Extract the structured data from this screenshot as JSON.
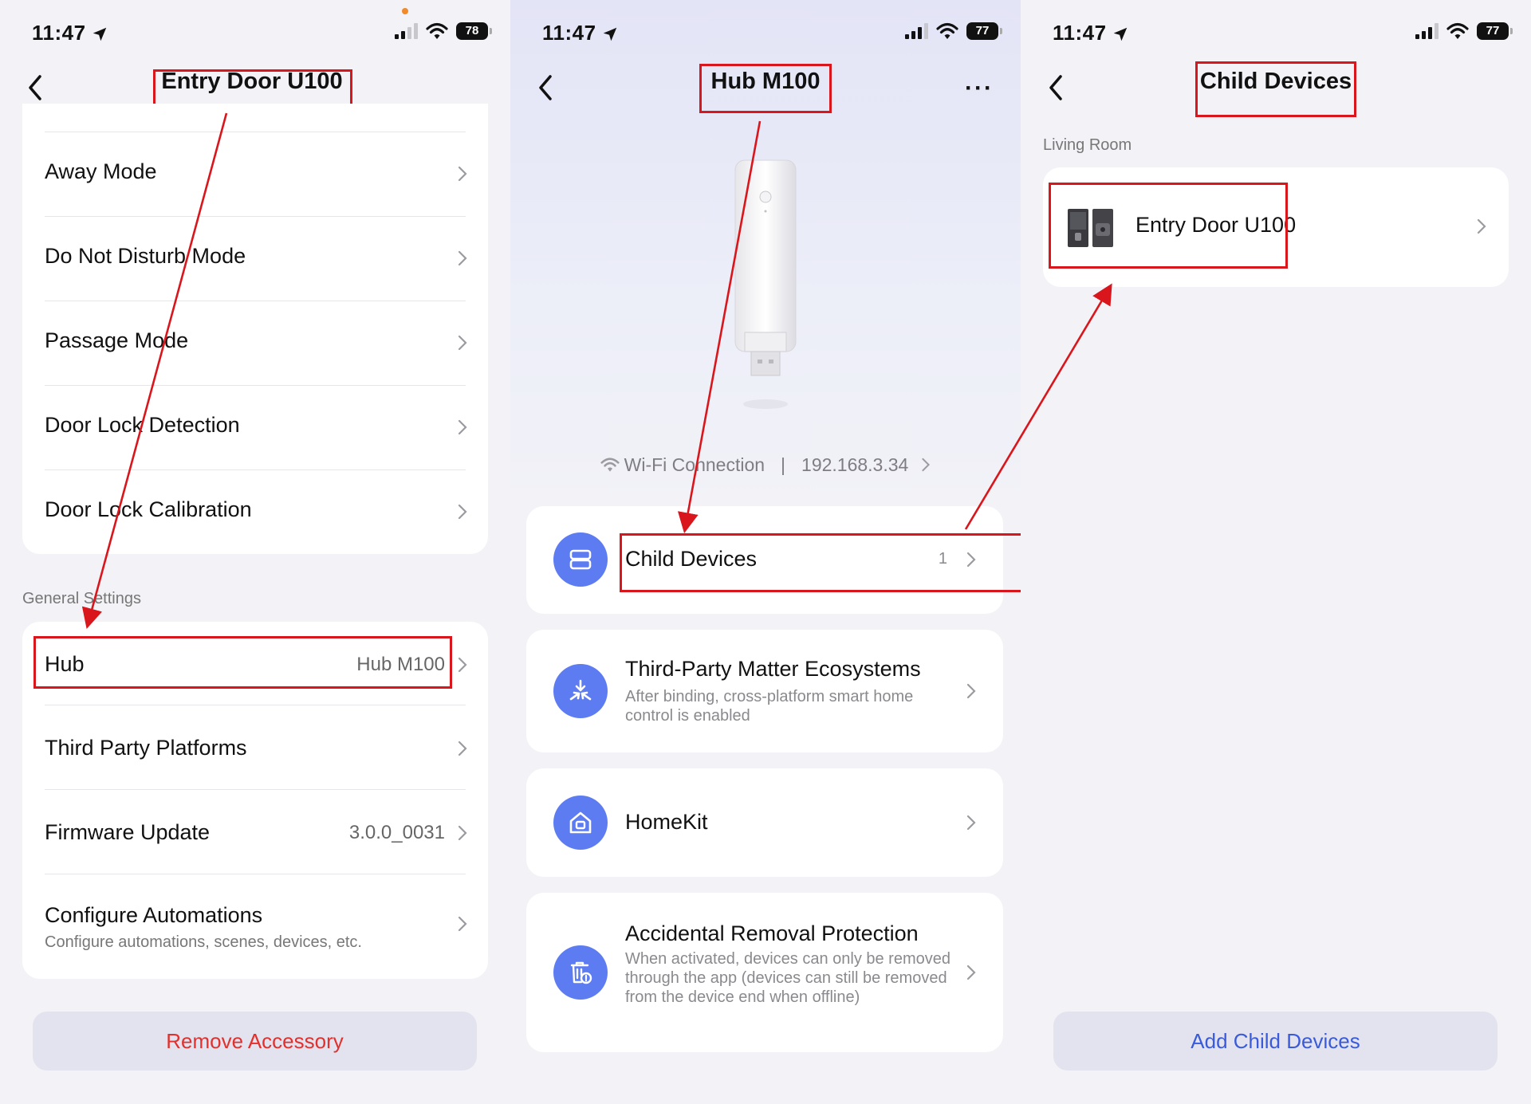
{
  "status_bar": {
    "p1": {
      "time": "11:47",
      "battery": "78"
    },
    "p2": {
      "time": "11:47",
      "battery": "77"
    },
    "p3": {
      "time": "11:47",
      "battery": "77"
    }
  },
  "screen1": {
    "title": "Entry Door U100",
    "rows": [
      {
        "label": "Away Mode"
      },
      {
        "label": "Do Not Disturb Mode"
      },
      {
        "label": "Passage Mode"
      },
      {
        "label": "Door Lock Detection"
      },
      {
        "label": "Door Lock Calibration"
      }
    ],
    "section": "General Settings",
    "settings": [
      {
        "label": "Hub",
        "value": "Hub M100"
      },
      {
        "label": "Third Party Platforms",
        "value": ""
      },
      {
        "label": "Firmware Update",
        "value": "3.0.0_0031"
      },
      {
        "label": "Configure Automations",
        "value": "",
        "sub": "Configure automations, scenes, devices, etc."
      }
    ],
    "remove_button": "Remove Accessory"
  },
  "screen2": {
    "title": "Hub M100",
    "wifi_label": "Wi-Fi Connection",
    "separator": "|",
    "ip": "192.168.3.34",
    "items": [
      {
        "title": "Child Devices",
        "count": "1",
        "sub": ""
      },
      {
        "title": "Third-Party Matter Ecosystems",
        "sub": "After binding, cross-platform smart home control is enabled"
      },
      {
        "title": "HomeKit",
        "sub": ""
      },
      {
        "title": "Accidental Removal Protection",
        "sub": "When activated, devices can only be removed through the app (devices can still be removed from the device end when offline)"
      }
    ]
  },
  "screen3": {
    "title": "Child Devices",
    "section": "Living Room",
    "device": "Entry Door U100",
    "add_button": "Add Child Devices"
  },
  "colors": {
    "accent": "#5e7cf2",
    "annotation_red": "#d9161c",
    "remove_red": "#e2302c",
    "add_blue": "#3a5bd9",
    "background": "#f2f2f7"
  }
}
